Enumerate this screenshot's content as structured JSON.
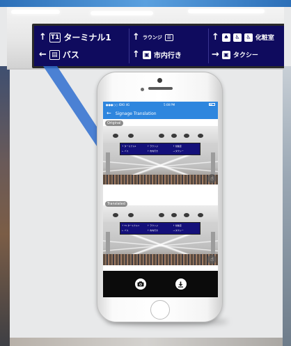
{
  "sign": {
    "terminal_box": "T1",
    "terminal_text": "ターミナル1",
    "bus_text": "バス",
    "lounge_text": "ラウンジ",
    "city_text": "市内行き",
    "restroom_text": "化粧室",
    "taxi_text": "タクシー"
  },
  "phone": {
    "status": {
      "carrier": "●●●○○ IDIO 4G",
      "time": "5:08 PM",
      "battery": "▪ 3%"
    },
    "nav": {
      "back_glyph": "←",
      "title": "Signage Translation"
    },
    "panels": {
      "original_label": "Original",
      "translated_label": "Translated"
    },
    "mini_sign_original": [
      "↑ ターミナル1",
      "↑ ラウンジ",
      "↑ 化粧室",
      "← バス",
      "↑ 市内行き",
      "→ タクシー"
    ],
    "mini_sign_translated": [
      "↑ T1 ターミナル1",
      "↑ ラウンジ",
      "↑ 化粧室",
      "← バス",
      "↑ 市内行き",
      "→ タクシー"
    ]
  },
  "colors": {
    "accent": "#2e86de",
    "sign_bg": "#0f0b5e",
    "toolbar_bg": "#0b0b0b"
  },
  "icons": [
    "camera-icon",
    "download-icon",
    "hand-icon",
    "back-arrow-icon"
  ]
}
